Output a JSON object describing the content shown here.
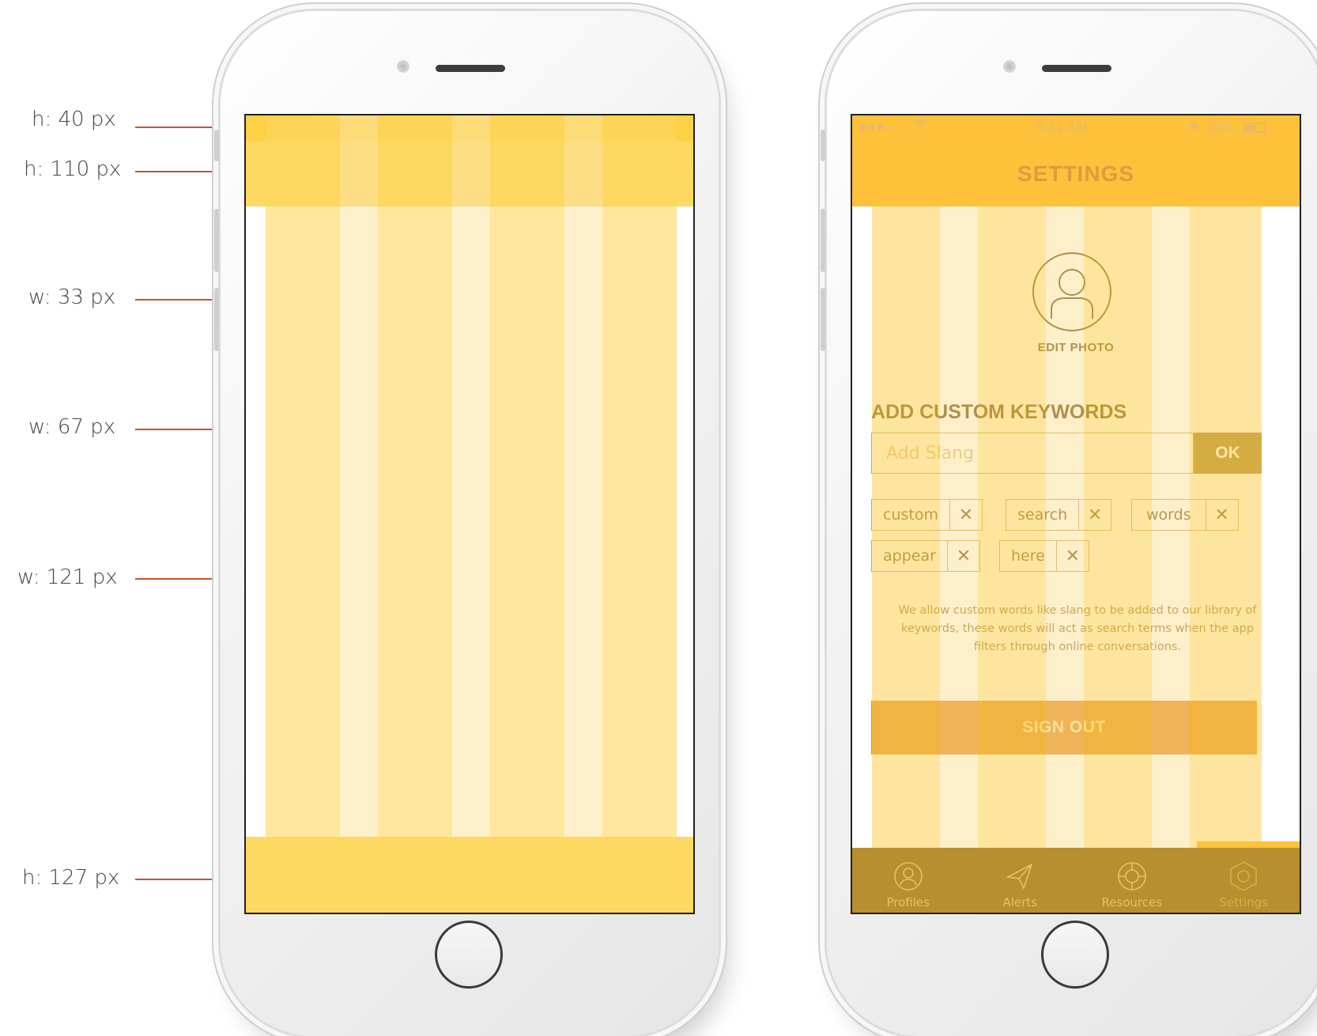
{
  "annotations": [
    {
      "label": "h: 40 px"
    },
    {
      "label": "h: 110 px"
    },
    {
      "label": "w: 33 px"
    },
    {
      "label": "w: 67 px"
    },
    {
      "label": "w: 121 px"
    },
    {
      "label": "h: 127 px"
    }
  ],
  "status_bar": {
    "signal": "●●●○○",
    "time": "9:41 AM",
    "battery": "58%"
  },
  "header": {
    "title": "SETTINGS"
  },
  "profile": {
    "edit_photo_label": "EDIT PHOTO"
  },
  "keywords": {
    "section_title": "ADD CUSTOM KEYWORDS",
    "input_placeholder": "Add Slang",
    "ok_label": "OK",
    "tags": [
      "custom",
      "search",
      "words",
      "appear",
      "here"
    ],
    "remove_icon": "close-icon",
    "description": "We allow custom words like slang to be added to our library of keywords, these words will act as search terms when the app filters through online conversations."
  },
  "sign_out_label": "SIGN OUT",
  "tab_bar": {
    "items": [
      {
        "label": "Profiles",
        "icon": "profile-icon"
      },
      {
        "label": "Alerts",
        "icon": "paper-plane-icon"
      },
      {
        "label": "Resources",
        "icon": "lifebuoy-icon"
      },
      {
        "label": "Settings",
        "icon": "hexagon-settings-icon"
      }
    ],
    "active": "Settings"
  },
  "colors": {
    "primary": "#fdc23a",
    "grid_column": "#fde497",
    "grid_gutter": "#fdefcb",
    "dark_text": "#6e531d",
    "accent_button": "#a4822f",
    "signout": "#e3932f",
    "annotation_line": "#c6532f"
  }
}
